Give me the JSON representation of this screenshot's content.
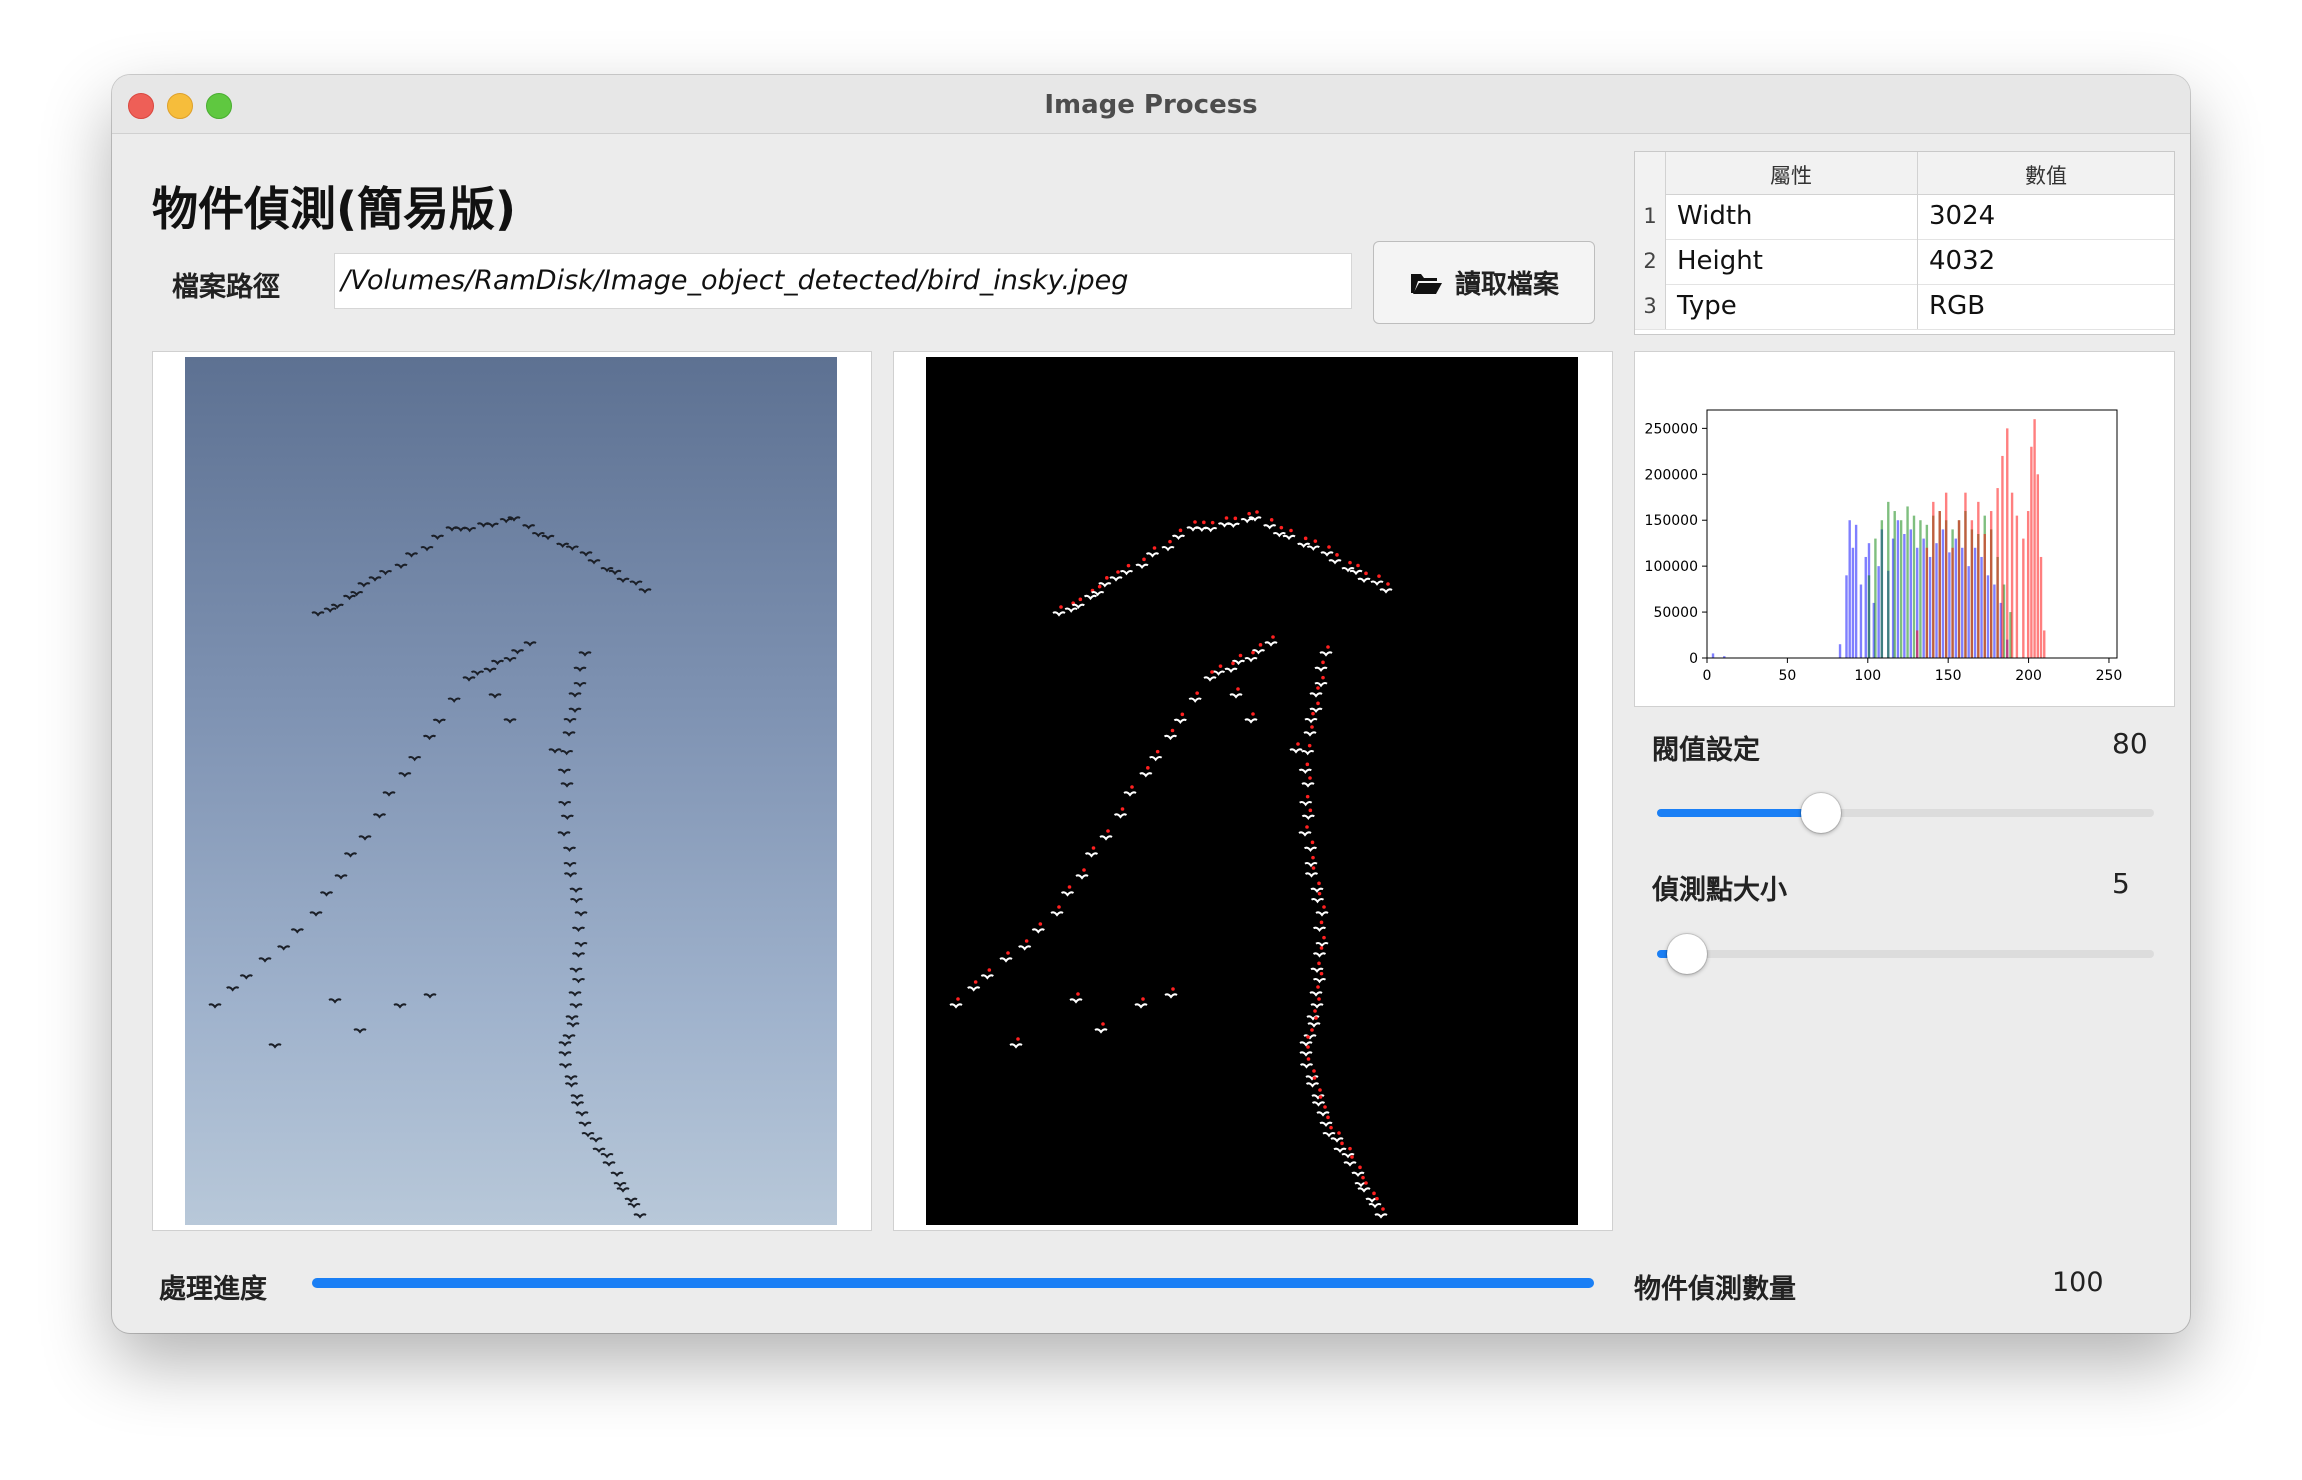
{
  "window": {
    "title": "Image Process"
  },
  "header": {
    "title": "物件偵測(簡易版)"
  },
  "file": {
    "label": "檔案路徑",
    "path": "/Volumes/RamDisk/Image_object_detected/bird_insky.jpeg",
    "open_button_label": "讀取檔案",
    "open_button_icon": "folder-open-icon"
  },
  "properties": {
    "columns": [
      "屬性",
      "數值"
    ],
    "rows": [
      {
        "index": "1",
        "name": "Width",
        "value": "3024"
      },
      {
        "index": "2",
        "name": "Height",
        "value": "4032"
      },
      {
        "index": "3",
        "name": "Type",
        "value": "RGB"
      }
    ]
  },
  "histogram": {
    "chart_data": {
      "type": "bar",
      "xlim": [
        0,
        255
      ],
      "ylim": [
        0,
        270000
      ],
      "x_ticks": [
        "0",
        "50",
        "100",
        "150",
        "200",
        "250"
      ],
      "y_ticks": [
        "0",
        "50000",
        "100000",
        "150000",
        "200000",
        "250000"
      ],
      "series": [
        {
          "color": "#0000ff",
          "bins": [
            [
              3,
              5000
            ],
            [
              10,
              2000
            ],
            [
              82,
              15000
            ],
            [
              86,
              90000
            ],
            [
              88,
              150000
            ],
            [
              90,
              120000
            ],
            [
              92,
              145000
            ],
            [
              95,
              80000
            ],
            [
              98,
              110000
            ],
            [
              100,
              125000
            ],
            [
              103,
              60000
            ],
            [
              106,
              100000
            ],
            [
              108,
              140000
            ],
            [
              112,
              95000
            ],
            [
              115,
              130000
            ],
            [
              118,
              150000
            ],
            [
              122,
              135000
            ],
            [
              126,
              140000
            ],
            [
              130,
              120000
            ],
            [
              134,
              130000
            ],
            [
              138,
              110000
            ],
            [
              142,
              125000
            ],
            [
              146,
              140000
            ],
            [
              150,
              115000
            ],
            [
              154,
              130000
            ],
            [
              158,
              120000
            ],
            [
              162,
              100000
            ],
            [
              166,
              120000
            ],
            [
              170,
              110000
            ],
            [
              174,
              90000
            ],
            [
              178,
              80000
            ],
            [
              182,
              60000
            ],
            [
              186,
              20000
            ]
          ]
        },
        {
          "color": "#008000",
          "bins": [
            [
              100,
              90000
            ],
            [
              104,
              130000
            ],
            [
              108,
              150000
            ],
            [
              112,
              170000
            ],
            [
              116,
              160000
            ],
            [
              120,
              150000
            ],
            [
              124,
              165000
            ],
            [
              128,
              155000
            ],
            [
              132,
              150000
            ],
            [
              136,
              145000
            ],
            [
              140,
              155000
            ],
            [
              144,
              160000
            ],
            [
              148,
              150000
            ],
            [
              152,
              140000
            ],
            [
              156,
              150000
            ],
            [
              160,
              160000
            ],
            [
              164,
              140000
            ],
            [
              168,
              135000
            ],
            [
              172,
              155000
            ],
            [
              176,
              140000
            ],
            [
              180,
              110000
            ],
            [
              184,
              80000
            ],
            [
              188,
              50000
            ]
          ]
        },
        {
          "color": "#ff0000",
          "bins": [
            [
              130,
              30000
            ],
            [
              136,
              120000
            ],
            [
              140,
              170000
            ],
            [
              144,
              160000
            ],
            [
              148,
              180000
            ],
            [
              152,
              120000
            ],
            [
              156,
              150000
            ],
            [
              160,
              180000
            ],
            [
              164,
              150000
            ],
            [
              168,
              170000
            ],
            [
              172,
              135000
            ],
            [
              176,
              160000
            ],
            [
              180,
              185000
            ],
            [
              183,
              220000
            ],
            [
              186,
              250000
            ],
            [
              189,
              180000
            ],
            [
              192,
              155000
            ],
            [
              196,
              130000
            ],
            [
              199,
              160000
            ],
            [
              201,
              230000
            ],
            [
              203,
              260000
            ],
            [
              205,
              200000
            ],
            [
              207,
              110000
            ],
            [
              209,
              30000
            ]
          ]
        }
      ]
    }
  },
  "threshold": {
    "label": "閥值設定",
    "value": "80",
    "fraction": 0.33
  },
  "dot_size": {
    "label": "偵測點大小",
    "value": "5",
    "fraction": 0.06
  },
  "progress": {
    "label": "處理進度",
    "fraction": 1.0
  },
  "detected": {
    "label": "物件偵測數量",
    "value": "100"
  },
  "colors": {
    "accent": "#1a7ff5",
    "marker": "#ff2020"
  }
}
